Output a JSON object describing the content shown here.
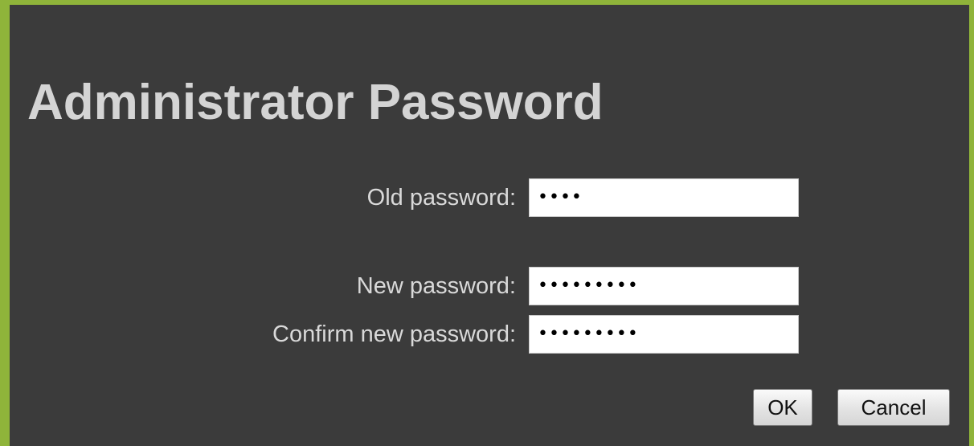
{
  "dialog": {
    "title": "Administrator Password",
    "accent_color": "#8fb43a",
    "background_color": "#3b3b3b"
  },
  "form": {
    "old_password": {
      "label": "Old password:",
      "value_masked": "••••"
    },
    "new_password": {
      "label": "New password:",
      "value_masked": "•••••••••"
    },
    "confirm_password": {
      "label": "Confirm new password:",
      "value_masked": "•••••••••"
    }
  },
  "buttons": {
    "ok_label": "OK",
    "cancel_label": "Cancel"
  }
}
